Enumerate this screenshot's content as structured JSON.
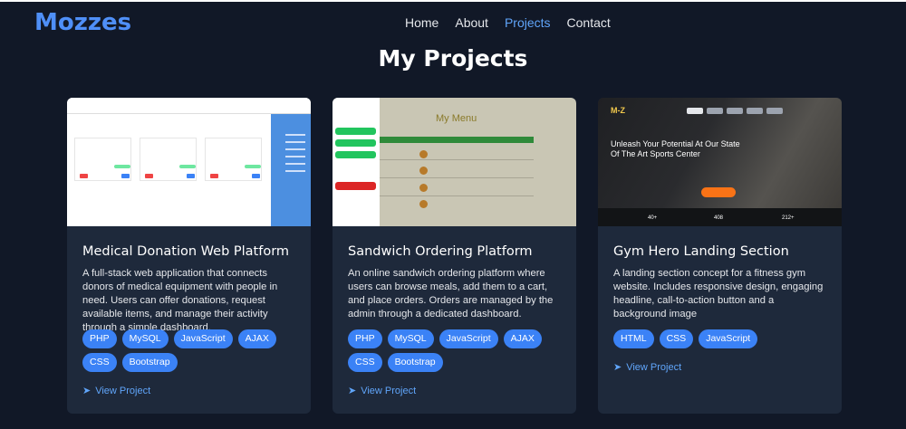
{
  "header": {
    "logo": "Mozzes",
    "nav": [
      {
        "label": "Home",
        "active": false
      },
      {
        "label": "About",
        "active": false
      },
      {
        "label": "Projects",
        "active": true
      },
      {
        "label": "Contact",
        "active": false
      }
    ]
  },
  "page_title": "My Projects",
  "projects": [
    {
      "title": "Medical Donation Web Platform",
      "description": "A full-stack web application that connects donors of medical equipment with people in need. Users can offer donations, request available items, and manage their activity through a simple dashboard.",
      "tags": [
        "PHP",
        "MySQL",
        "JavaScript",
        "AJAX",
        "CSS",
        "Bootstrap"
      ],
      "link": "View Project",
      "link_icon": "arrow-right-icon"
    },
    {
      "title": "Sandwich Ordering Platform",
      "description": "An online sandwich ordering platform where users can browse meals, add them to a cart, and place orders. Orders are managed by the admin through a dedicated dashboard.",
      "tags": [
        "PHP",
        "MySQL",
        "JavaScript",
        "AJAX",
        "CSS",
        "Bootstrap"
      ],
      "link": "View Project",
      "link_icon": "arrow-right-icon"
    },
    {
      "title": "Gym Hero Landing Section",
      "description": "A landing section concept for a fitness gym website. Includes responsive design, engaging headline, call-to-action button and a background image",
      "tags": [
        "HTML",
        "CSS",
        "JavaScript"
      ],
      "link": "View Project",
      "link_icon": "arrow-right-icon"
    }
  ],
  "thumbnails": {
    "sandwich_menu_title": "My Menu",
    "gym_logo": "M-Z",
    "gym_headline": "Unleash Your Potential At Our State Of The Art Sports Center",
    "gym_stats": [
      "40+",
      "408",
      "212+"
    ]
  },
  "colors": {
    "background": "#111827",
    "card": "#1e293b",
    "accent": "#3b82f6",
    "logo": "#4f8ff7",
    "link": "#60a5fa"
  }
}
